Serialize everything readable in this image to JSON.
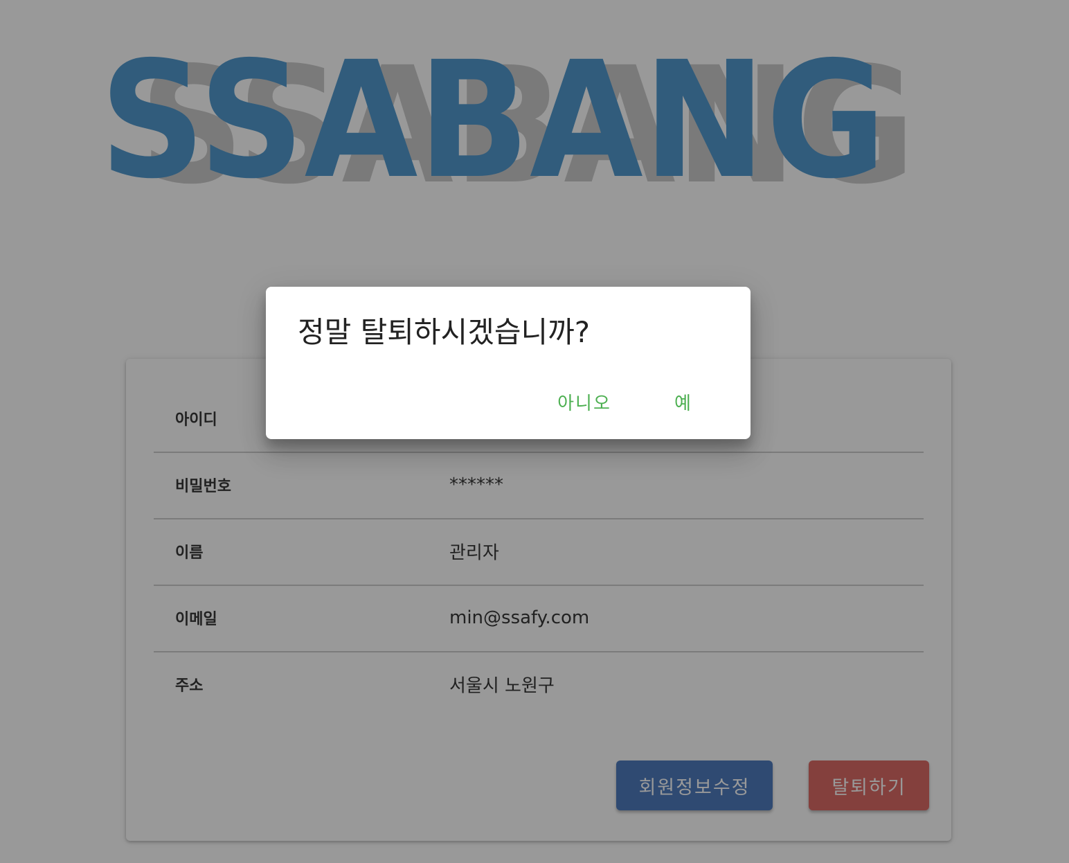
{
  "logo": {
    "text": "SSABANG",
    "front_color": "#3f8fca",
    "shadow_color": "#c6c6c6"
  },
  "profile": {
    "rows": [
      {
        "label": "아이디",
        "value": ""
      },
      {
        "label": "비밀번호",
        "value": "******"
      },
      {
        "label": "이름",
        "value": "관리자"
      },
      {
        "label": "이메일",
        "value": "min@ssafy.com"
      },
      {
        "label": "주소",
        "value": "서울시 노원구"
      }
    ],
    "edit_button": "회원정보수정",
    "withdraw_button": "탈퇴하기"
  },
  "dialog": {
    "title": "정말 탈퇴하시겠습니까?",
    "no_label": "아니오",
    "yes_label": "예"
  },
  "colors": {
    "edit_button": "#3b6db8",
    "withdraw_button": "#d95b56",
    "dialog_action": "#4caf50",
    "overlay": "rgba(33,33,33,0.46)"
  }
}
